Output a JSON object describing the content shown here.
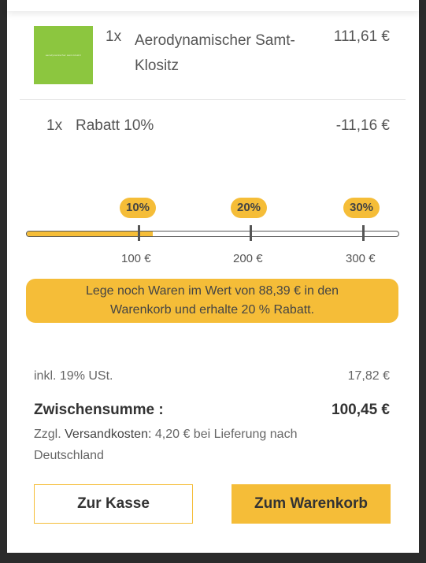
{
  "items": [
    {
      "qty": "1x",
      "name": "Aerodynamischer Samt-Klositz",
      "price": "111,61 €",
      "thumb_text": "aerodynamischer samt-klositz"
    },
    {
      "qty": "1x",
      "name": "Rabatt 10%",
      "price": "-11,16 €"
    }
  ],
  "discount": {
    "tiers": [
      {
        "badge": "10%",
        "threshold": "100 €"
      },
      {
        "badge": "20%",
        "threshold": "200 €"
      },
      {
        "badge": "30%",
        "threshold": "300 €"
      }
    ],
    "progress_fraction": 0.34,
    "notice": "Lege noch Waren im Wert von 88,39 € in den Warenkorb und erhalte 20 % Rabatt."
  },
  "totals": {
    "vat_label": "inkl. 19% USt.",
    "vat_value": "17,82 €",
    "subtotal_label": "Zwischensumme :",
    "subtotal_value": "100,45 €",
    "shipping_prefix": "Zzgl.",
    "shipping_label": "Versandkosten:",
    "shipping_text": "4,20 € bei Lieferung nach Deutschland"
  },
  "buttons": {
    "checkout": "Zur Kasse",
    "cart": "Zum Warenkorb"
  },
  "colors": {
    "accent": "#f5bd38",
    "thumb": "#8cc63f",
    "backdrop": "#2b2b2b"
  }
}
